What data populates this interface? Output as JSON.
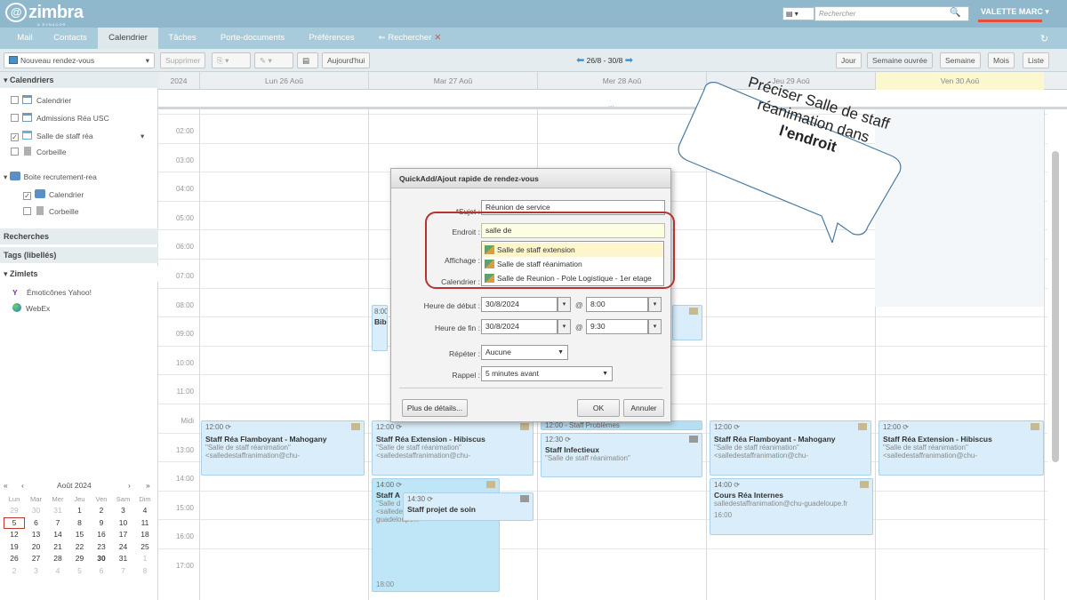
{
  "header": {
    "logo": "zimbra",
    "logo_sub": "A SYNACOR PRODUCT",
    "search_placeholder": "Rechercher",
    "user": "VALETTE MARC"
  },
  "tabs": {
    "mail": "Mail",
    "contacts": "Contacts",
    "calendar": "Calendrier",
    "tasks": "Tâches",
    "briefcase": "Porte-documents",
    "prefs": "Préférences",
    "search": "Rechercher"
  },
  "toolbar": {
    "new_appt": "Nouveau rendez-vous",
    "delete": "Supprimer",
    "today": "Aujourd'hui",
    "range": "26/8 - 30/8",
    "views": [
      "Jour",
      "Semaine ouvrée",
      "Semaine",
      "Mois",
      "Liste"
    ]
  },
  "sidebar": {
    "calendars_head": "Calendriers",
    "items": [
      "Calendrier",
      "Admissions Réa USC",
      "Salle de staff réa",
      "Corbeille"
    ],
    "shared_head": "Boite recrutement-rea",
    "shared_items": [
      "Calendrier",
      "Corbeille"
    ],
    "searches_head": "Recherches",
    "tags_head": "Tags (libellés)",
    "zimlets_head": "Zimlets",
    "zimlets": [
      "Émoticônes Yahoo!",
      "WebEx"
    ]
  },
  "minical": {
    "month": "Août 2024",
    "dow": [
      "Lun",
      "Mar",
      "Mer",
      "Jeu",
      "Ven",
      "Sam",
      "Dim"
    ],
    "weeks": [
      [
        "29",
        "30",
        "31",
        "1",
        "2",
        "3",
        "4"
      ],
      [
        "5",
        "6",
        "7",
        "8",
        "9",
        "10",
        "11"
      ],
      [
        "12",
        "13",
        "14",
        "15",
        "16",
        "17",
        "18"
      ],
      [
        "19",
        "20",
        "21",
        "22",
        "23",
        "24",
        "25"
      ],
      [
        "26",
        "27",
        "28",
        "29",
        "30",
        "31",
        "1"
      ],
      [
        "2",
        "3",
        "4",
        "5",
        "6",
        "7",
        "8"
      ]
    ]
  },
  "grid": {
    "year": "2024",
    "days": [
      "Lun 26 Aoû",
      "Mar 27 Aoû",
      "Mer 28 Aoû",
      "Jeu 29 Aoû",
      "Ven 30 Aoû"
    ],
    "hours": [
      "02:00",
      "03:00",
      "04:00",
      "05:00",
      "06:00",
      "07:00",
      "08:00",
      "09:00",
      "10:00",
      "11:00",
      "Midi",
      "13:00",
      "14:00",
      "15:00",
      "16:00",
      "17:00"
    ],
    "allday_more": "..."
  },
  "appointments": {
    "a1": {
      "time": "12:00",
      "title": "Staff Réa Flamboyant - Mahogany",
      "loc1": "\"Salle de staff réanimation\"",
      "loc2": "<salledestaffranimation@chu-"
    },
    "a2": {
      "time": "12:00",
      "title": "Staff Réa Extension - Hibiscus",
      "loc1": "\"Salle de staff réanimation\"",
      "loc2": "<salledestaffranimation@chu-"
    },
    "a3": {
      "time": "12:00 - Staff Problèmes"
    },
    "a4": {
      "time": "12:30",
      "title": "Staff Infectieux",
      "loc1": "\"Salle de staff réanimation\""
    },
    "a5": {
      "time": "12:00",
      "title": "Staff Réa Flamboyant - Mahogany",
      "loc1": "\"Salle de staff réanimation\"",
      "loc2": "<salledestaffranimation@chu-"
    },
    "a6": {
      "time": "12:00",
      "title": "Staff Réa Extension - Hibiscus",
      "loc1": "\"Salle de staff réanimation\"",
      "loc2": "<salledestaffranimation@chu-"
    },
    "a7": {
      "time": "14:00",
      "title": "Staff A",
      "loc1": "\"Salle d",
      "loc2": "<salledestaffranimation@chu-",
      "loc3": "guadeloupe.fr>",
      "end": "18:00"
    },
    "a8": {
      "time": "14:30",
      "title": "Staff projet de soin"
    },
    "a9": {
      "time": "14:00",
      "title": "Cours Réa Internes",
      "loc1": "salledestaffranimation@chu-guadeloupe.fr",
      "end": "16:00"
    },
    "a10": {
      "time": "8:00",
      "title": "Bibl"
    }
  },
  "dialog": {
    "title": "QuickAdd/Ajout rapide de rendez-vous",
    "subject_label": "Sujet :",
    "subject_value": "Réunion de service",
    "location_label": "Endroit :",
    "location_value": "salle de",
    "display_label": "Affichage :",
    "calendar_label": "Calendrier :",
    "start_label": "Heure de début :",
    "start_date": "30/8/2024",
    "start_time": "8:00",
    "end_label": "Heure de fin :",
    "end_date": "30/8/2024",
    "end_time": "9:30",
    "repeat_label": "Répéter :",
    "repeat_value": "Aucune",
    "reminder_label": "Rappel :",
    "reminder_value": "5 minutes avant",
    "more_details": "Plus de détails...",
    "ok": "OK",
    "cancel": "Annuler"
  },
  "autocomplete": [
    "Salle de staff extension",
    "Salle de staff réanimation",
    "Salle de Reunion - Pole Logistique - 1er etage"
  ],
  "callout": {
    "line1": "Préciser Salle de staff",
    "line2": "réanimation dans",
    "line3": "l'endroit"
  }
}
